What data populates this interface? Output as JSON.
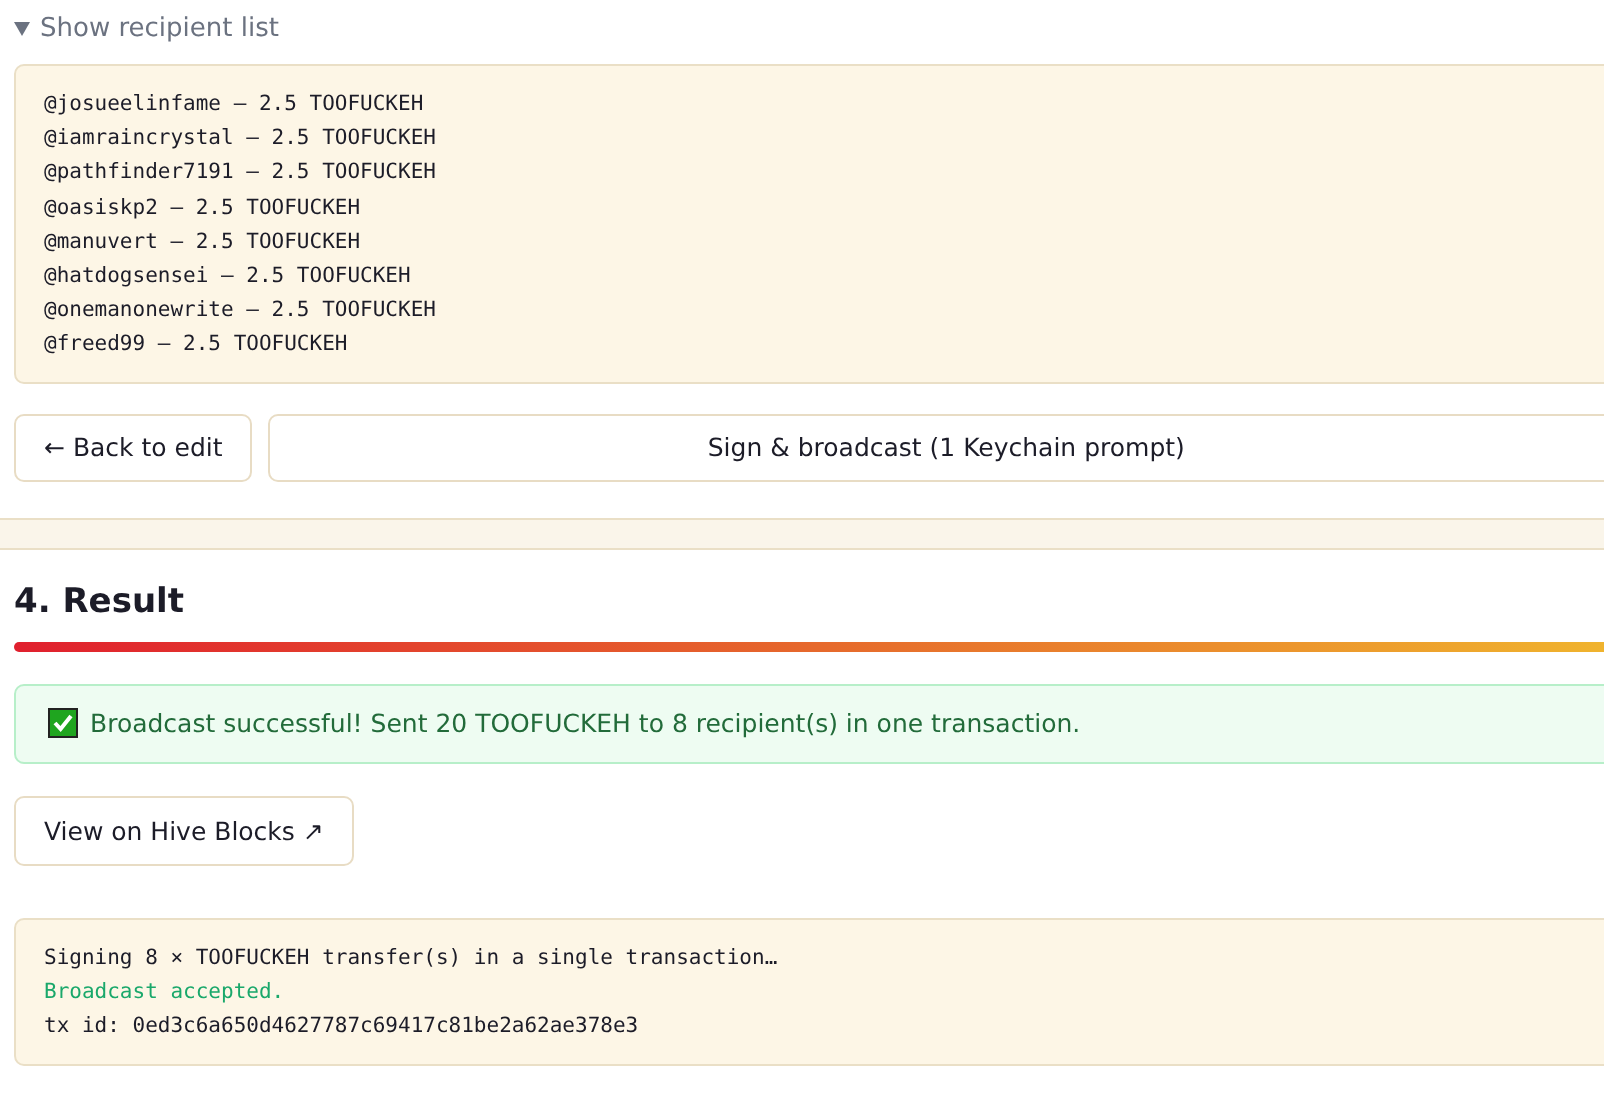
{
  "recipients": {
    "toggle": "Show recipient list",
    "expanded": true,
    "lines": [
      "@josueelinfame — 2.5 TOOFUCKEH",
      "@iamraincrystal — 2.5 TOOFUCKEH",
      "@pathfinder7191 — 2.5 TOOFUCKEH",
      "@oasiskp2 — 2.5 TOOFUCKEH",
      "@manuvert — 2.5 TOOFUCKEH",
      "@hatdogsensei — 2.5 TOOFUCKEH",
      "@onemanonewrite — 2.5 TOOFUCKEH",
      "@freed99 — 2.5 TOOFUCKEH"
    ]
  },
  "actions": {
    "back": "← Back to edit",
    "sign": "Sign & broadcast (1 Keychain prompt)"
  },
  "result": {
    "heading": "4. Result",
    "alert": "Broadcast successful! Sent 20 TOOFUCKEH to 8 recipient(s) in one transaction.",
    "link": "View on Hive Blocks ↗",
    "log": [
      {
        "kind": "info",
        "text": "Signing 8 × TOOFUCKEH transfer(s) in a single transaction…"
      },
      {
        "kind": "success",
        "text": "Broadcast accepted."
      },
      {
        "kind": "info",
        "text": "tx id: 0ed3c6a650d4627787c69417c81be2a62ae378e3"
      }
    ]
  }
}
